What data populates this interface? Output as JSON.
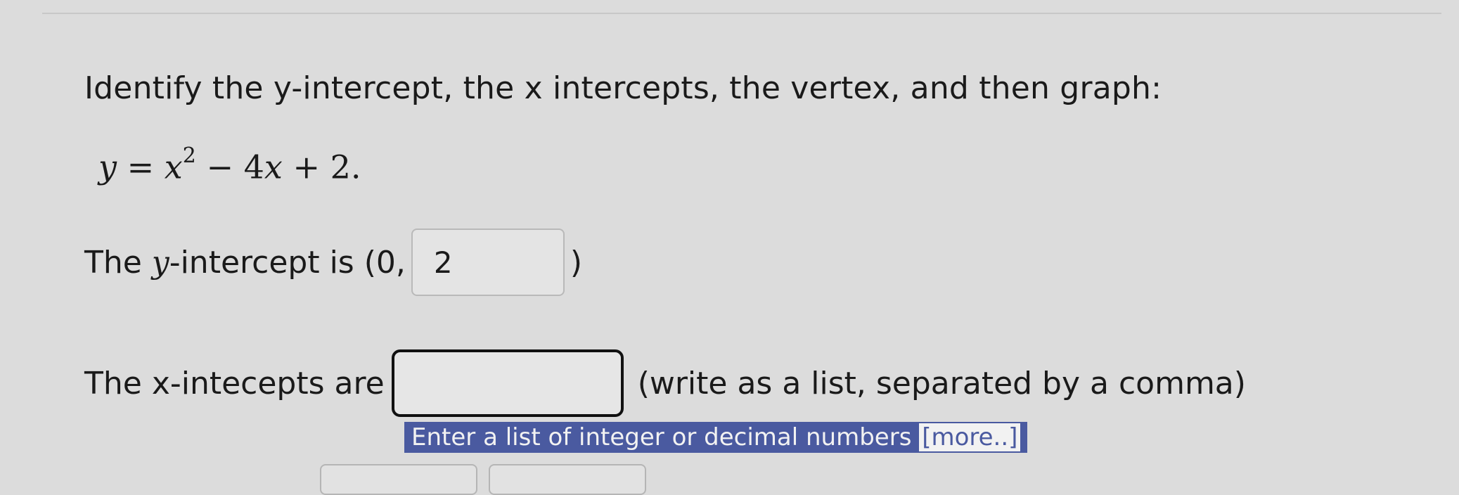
{
  "question": {
    "text": "Identify the y-intercept, the x intercepts, the vertex, and then graph:"
  },
  "equation": {
    "y": "y",
    "eq": " = ",
    "x": "x",
    "exp": "2",
    "rest_minus": " − 4",
    "x2": "x",
    "rest_plus": " + 2."
  },
  "y_intercept": {
    "prefix_the": "The ",
    "y": "y",
    "prefix_rest": "-intercept is (0, ",
    "value": "2",
    "suffix": ")"
  },
  "x_intercepts": {
    "label": "The x-intecepts are",
    "value": "",
    "instruction": "(write as a list, separated by a comma)",
    "hint": "Enter a list of integer or decimal numbers ",
    "hint_more": "[more..]"
  }
}
